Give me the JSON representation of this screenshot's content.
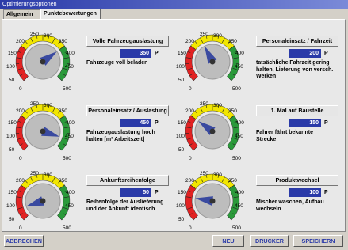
{
  "window": {
    "title": "Optimierungsoptionen"
  },
  "tabs": [
    {
      "label": "Allgemein",
      "active": false
    },
    {
      "label": "Punktebewertungen",
      "active": true
    }
  ],
  "gauge_scale": {
    "min": 0,
    "max": 500,
    "ticks": [
      "0",
      "50",
      "100",
      "150",
      "200",
      "250",
      "300",
      "350",
      "400",
      "450",
      "500"
    ]
  },
  "unit": "P",
  "criteria": [
    {
      "title": "Volle Fahrzeugauslastung",
      "value": "350",
      "description": "Fahrzeuge voll beladen"
    },
    {
      "title": "Personaleinsatz / Fahrzeit",
      "value": "200",
      "description": "tatsächliche Fahrzeit gering halten, Lieferung von versch. Werken"
    },
    {
      "title": "Personaleinsatz / Auslastung",
      "value": "450",
      "description": "Fahrzeugauslastung hoch halten [m³ Arbeitszeit]"
    },
    {
      "title": "1. Mal auf Baustelle",
      "value": "150",
      "description": "Fahrer fährt bekannte Strecke"
    },
    {
      "title": "Ankunftsreihenfolge",
      "value": "50",
      "description": "Reihenfolge der Auslieferung und der Ankunft identisch"
    },
    {
      "title": "Produktwechsel",
      "value": "100",
      "description": "Mischer waschen, Aufbau wechseln"
    }
  ],
  "buttons": {
    "cancel": "ABBRECHEN",
    "new": "NEU",
    "print": "DRUCKER",
    "save": "SPEICHERN"
  },
  "colors": {
    "accent": "#2a3aa8",
    "red": "#e22222",
    "yellow": "#f2e600",
    "green": "#2a9a3a"
  }
}
